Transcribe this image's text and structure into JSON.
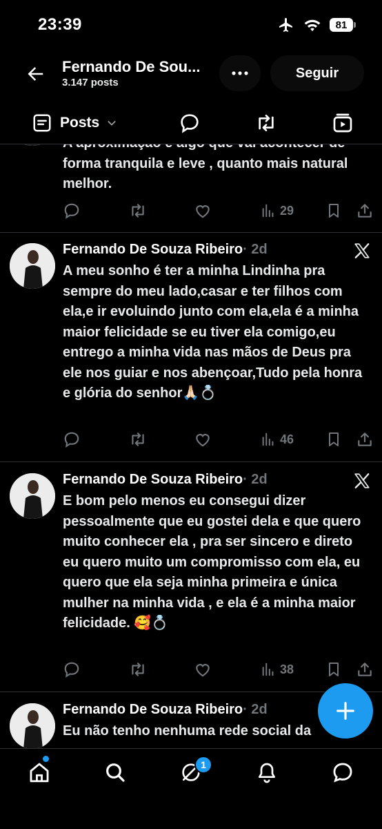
{
  "status_bar": {
    "time": "23:39",
    "battery": "81"
  },
  "header": {
    "name": "Fernando De Sou...",
    "post_count": "3.147 posts",
    "follow_label": "Seguir"
  },
  "tabs": {
    "posts_label": "Posts"
  },
  "posts": [
    {
      "text": "A aproximação é algo que vai acontecer de forma tranquila e leve , quanto mais natural melhor.",
      "views": "29"
    },
    {
      "author": "Fernando De Souza Ribeiro",
      "meta": "· 2d",
      "text": "A meu sonho é ter a minha Lindinha pra sempre do meu lado,casar e ter filhos com ela,e ir evoluindo junto com ela,ela é a minha maior felicidade se eu tiver ela comigo,eu entrego a minha vida nas mãos de Deus pra ele nos guiar e nos abençoar,Tudo pela honra e glória do senhor🙏🏻💍",
      "views": "46"
    },
    {
      "author": "Fernando De Souza Ribeiro",
      "meta": "· 2d",
      "text": "E bom pelo menos eu consegui dizer pessoalmente que eu gostei dela e que quero muito conhecer ela , pra ser sincero e direto eu quero muito um compromisso com ela, eu quero que ela seja minha primeira e única mulher na minha vida , e ela é a minha maior felicidade. 🥰💍",
      "views": "38"
    },
    {
      "author": "Fernando De Souza Ribeiro",
      "meta": "· 2d",
      "text": "Eu não tenho nenhuma rede social da"
    }
  ],
  "bottom_nav": {
    "messages_badge": "1"
  },
  "icons": [
    "back-arrow-icon",
    "more-icon",
    "posts-tab-icon",
    "chevron-down-icon",
    "reply-tab-icon",
    "repost-tab-icon",
    "media-tab-icon",
    "reply-icon",
    "repost-icon",
    "like-icon",
    "views-icon",
    "bookmark-icon",
    "share-icon",
    "x-logo-icon",
    "compose-plus-icon",
    "home-icon",
    "search-icon",
    "grok-icon",
    "notifications-icon",
    "messages-icon"
  ],
  "colors": {
    "accent": "#1d9bf0",
    "background": "#000000",
    "muted": "#71767b",
    "text": "#e7e9ea"
  }
}
